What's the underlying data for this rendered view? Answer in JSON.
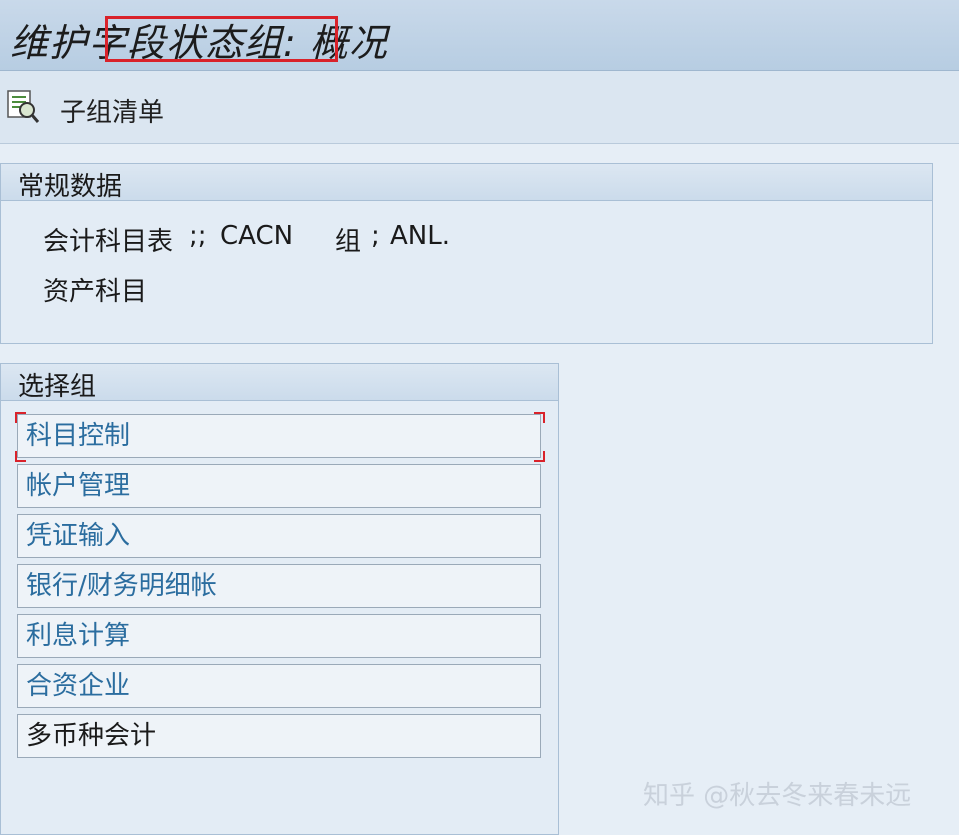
{
  "header": {
    "title": "维护字段状态组: 概况"
  },
  "toolbar": {
    "icon": "document-magnifier-icon",
    "subgroup_list_label": "子组清单"
  },
  "general_data": {
    "title": "常规数据",
    "chart_of_accounts_label": "会计科目表",
    "chart_of_accounts_sep": ";;",
    "chart_of_accounts_value": "CACN",
    "group_label": "组",
    "group_sep": ";",
    "group_value": "ANL.",
    "group_description": "资产科目"
  },
  "selection_groups": {
    "title": "选择组",
    "items": [
      {
        "label": "科目控制"
      },
      {
        "label": "帐户管理"
      },
      {
        "label": "凭证输入"
      },
      {
        "label": "银行/财务明细帐"
      },
      {
        "label": "利息计算"
      },
      {
        "label": "合资企业"
      },
      {
        "label": "多币种会计"
      }
    ]
  },
  "watermark": "知乎 @秋去冬来春未远",
  "colors": {
    "highlight": "#d9222a",
    "link_text": "#2b6d9f"
  }
}
